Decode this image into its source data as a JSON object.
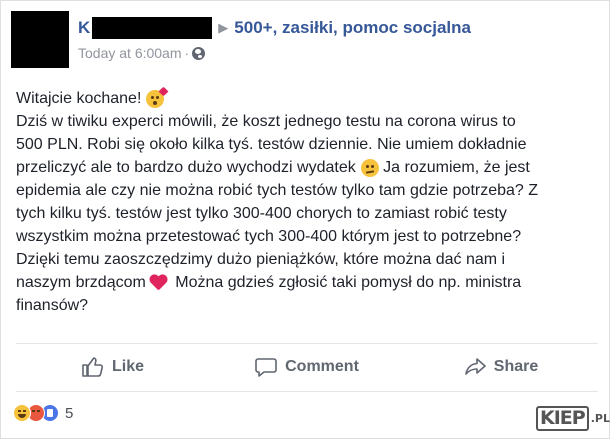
{
  "post": {
    "author": "K",
    "group": "500+, zasiłki, pomoc socjalna",
    "timestamp": "Today at 6:00am",
    "privacy_icon": "globe-icon",
    "lines": [
      "Witajcie kochane!",
      "Dziś w tiwiku experci mówili, że koszt jednego testu na corona wirus to",
      "500 PLN. Robi się około kilka tyś. testów dziennie. Nie umiem dokładnie",
      "przeliczyć ale to bardzo dużo wychodzi wydatek",
      " Ja rozumiem, że jest",
      "epidemia ale czy nie można robić tych testów tylko tam gdzie potrzeba? Z",
      "tych kilku tyś. testów jest tylko 300-400 chorych to zamiast robić testy",
      "wszystkim można przetestować tych 300-400 którym jest to potrzebne?",
      "Dzięki temu zaoszczędzimy dużo pieniążków, które można dać nam i",
      "naszym brzdącom",
      " Można gdzieś zgłosić taki pomysł do np. ministra",
      "finansów?"
    ]
  },
  "actions": {
    "like": "Like",
    "comment": "Comment",
    "share": "Share"
  },
  "reactions": {
    "icons": [
      "haha-icon",
      "angry-icon",
      "like-icon"
    ],
    "count": "5"
  },
  "watermark": {
    "brand": "KIEP",
    "suffix": ".PL"
  }
}
